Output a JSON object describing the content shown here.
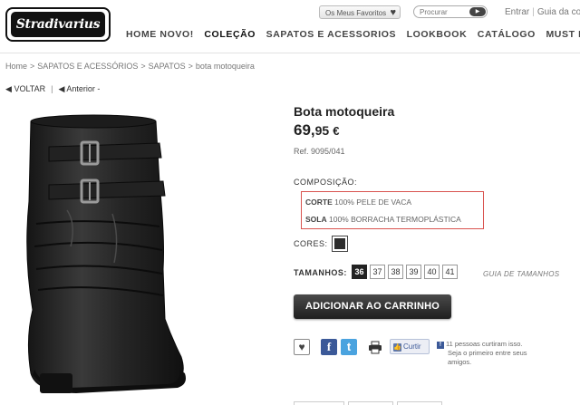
{
  "header": {
    "logo_text": "Stradivarius",
    "favorites_label": "Os Meus Favoritos",
    "search_placeholder": "Procurar",
    "login": "Entrar",
    "guide": "Guia da co",
    "nav": [
      "HOME NOVO!",
      "COLEÇÃO",
      "SAPATOS E ACESSORIOS",
      "LOOKBOOK",
      "CATÁLOGO",
      "MUST HAVE"
    ],
    "nav_active_index": 1
  },
  "breadcrumb": [
    "Home",
    "SAPATOS E ACESSÓRIOS",
    "SAPATOS",
    "bota motoqueira"
  ],
  "back_nav": {
    "back": "VOLTAR",
    "previous": "Anterior -"
  },
  "product": {
    "name": "Bota motoqueira",
    "price_integer": "69,",
    "price_decimal": "95",
    "currency": "€",
    "ref": "Ref. 9095/041",
    "composition_label": "COMPOSIÇÃO:",
    "composition": [
      {
        "part": "CORTE",
        "material": "100% PELE DE VACA"
      },
      {
        "part": "SOLA",
        "material": "100% BORRACHA TERMOPLÁSTICA"
      }
    ],
    "colors_label": "CORES:",
    "color_swatch": "#2c2c2c",
    "sizes_label": "TAMANHOS:",
    "sizes": [
      "36",
      "37",
      "38",
      "39",
      "40",
      "41"
    ],
    "selected_size": "36",
    "size_guide": "GUIA DE TAMANHOS",
    "add_to_cart": "ADICIONAR AO CARRINHO"
  },
  "social": {
    "like_label": "Curtir",
    "fb_line1": "11 pessoas curtiram isso.",
    "fb_line2": "Seja o primeiro entre seus",
    "fb_line3": "amigos.",
    "icons": [
      "heart-icon",
      "facebook-icon",
      "twitter-icon",
      "print-icon"
    ]
  }
}
